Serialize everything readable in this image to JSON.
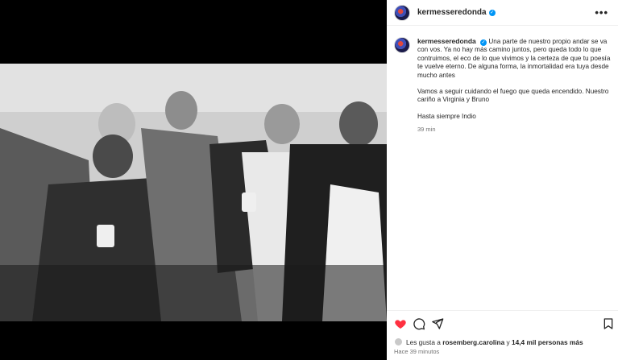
{
  "post": {
    "username": "kermesseredonda",
    "verified_mark": "✓",
    "more_icon": "•••",
    "caption_text": "Una parte de nuestro propio andar se va con vos. Ya no hay más camino juntos, pero queda todo lo que contruimos, el eco de lo que vivimos y la certeza de que tu poesía te vuelve eterno. De alguna forma, la inmortalidad era tuya desde mucho antes",
    "caption_p2": "Vamos a seguir cuidando el fuego que queda encendido. Nuestro cariño a Virginia y Bruno",
    "caption_p3": "Hasta siempre Indio",
    "caption_time": "39 min",
    "likes_prefix": "Les gusta a",
    "likes_user": "rosemberg.carolina",
    "likes_mid": "y",
    "likes_count": "14,4 mil personas más",
    "posted_ago": "Hace 39 minutos"
  },
  "icons": {
    "like": "heart-icon-filled",
    "comment": "comment-icon",
    "share": "share-icon",
    "save": "bookmark-icon"
  },
  "colors": {
    "heart": "#ff3040",
    "verified": "#0095f6",
    "muted_text": "#737373"
  }
}
